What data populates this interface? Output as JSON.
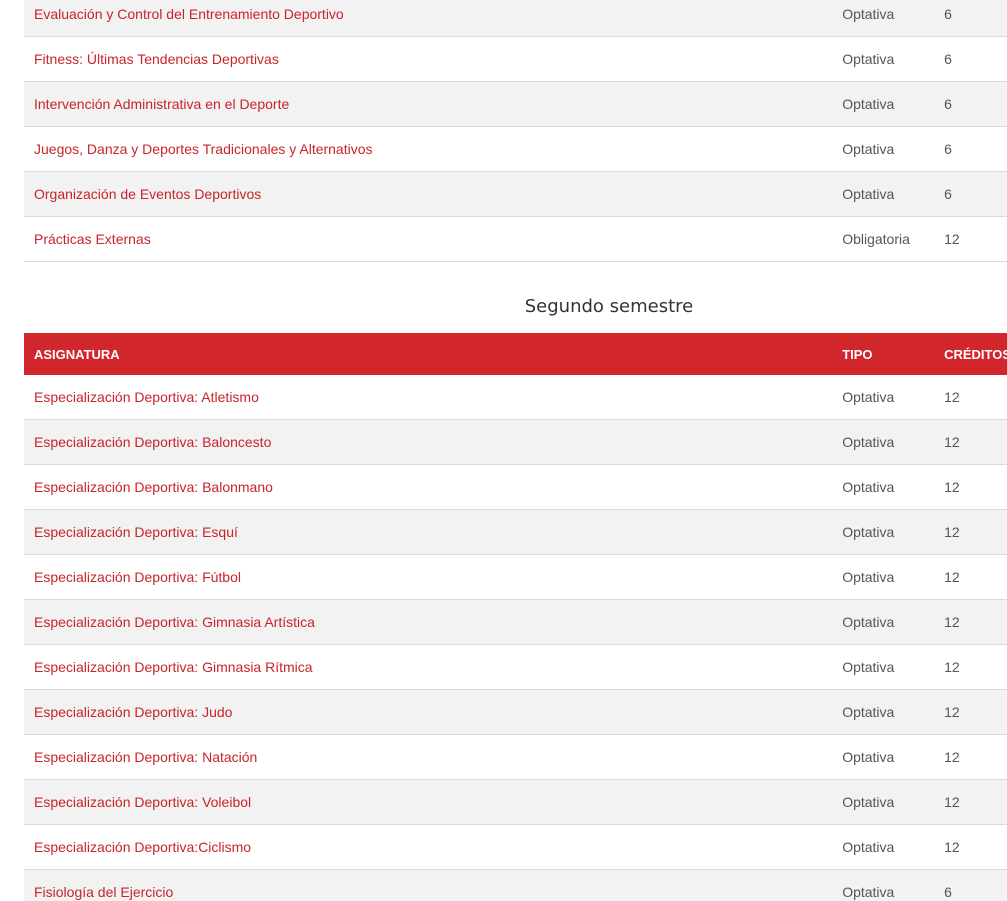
{
  "top_table": {
    "rows": [
      {
        "name": "Evaluación y Control del Entrenamiento Deportivo",
        "tipo": "Optativa",
        "creditos": "6"
      },
      {
        "name": "Fitness: Últimas Tendencias Deportivas",
        "tipo": "Optativa",
        "creditos": "6"
      },
      {
        "name": "Intervención Administrativa en el Deporte",
        "tipo": "Optativa",
        "creditos": "6"
      },
      {
        "name": "Juegos, Danza y Deportes Tradicionales y Alternativos",
        "tipo": "Optativa",
        "creditos": "6"
      },
      {
        "name": "Organización de Eventos Deportivos",
        "tipo": "Optativa",
        "creditos": "6"
      },
      {
        "name": "Prácticas Externas",
        "tipo": "Obligatoria",
        "creditos": "12"
      }
    ]
  },
  "second_semester": {
    "title": "Segundo semestre",
    "headers": {
      "asignatura": "ASIGNATURA",
      "tipo": "TIPO",
      "creditos": "CRÉDITOS"
    },
    "rows": [
      {
        "name": "Especialización Deportiva: Atletismo",
        "tipo": "Optativa",
        "creditos": "12"
      },
      {
        "name": "Especialización Deportiva: Baloncesto",
        "tipo": "Optativa",
        "creditos": "12"
      },
      {
        "name": "Especialización Deportiva: Balonmano",
        "tipo": "Optativa",
        "creditos": "12"
      },
      {
        "name": "Especialización Deportiva: Esquí",
        "tipo": "Optativa",
        "creditos": "12"
      },
      {
        "name": "Especialización Deportiva: Fútbol",
        "tipo": "Optativa",
        "creditos": "12"
      },
      {
        "name": "Especialización Deportiva: Gimnasia Artística",
        "tipo": "Optativa",
        "creditos": "12"
      },
      {
        "name": "Especialización Deportiva: Gimnasia Rítmica",
        "tipo": "Optativa",
        "creditos": "12"
      },
      {
        "name": "Especialización Deportiva: Judo",
        "tipo": "Optativa",
        "creditos": "12"
      },
      {
        "name": "Especialización Deportiva: Natación",
        "tipo": "Optativa",
        "creditos": "12"
      },
      {
        "name": "Especialización Deportiva: Voleibol",
        "tipo": "Optativa",
        "creditos": "12"
      },
      {
        "name": "Especialización Deportiva:Ciclismo",
        "tipo": "Optativa",
        "creditos": "12"
      },
      {
        "name": "Fisiología del Ejercicio",
        "tipo": "Optativa",
        "creditos": "6"
      }
    ]
  },
  "colors": {
    "accent": "#d2262d",
    "link": "#c8242b",
    "row_alt": "#f2f2f2"
  }
}
